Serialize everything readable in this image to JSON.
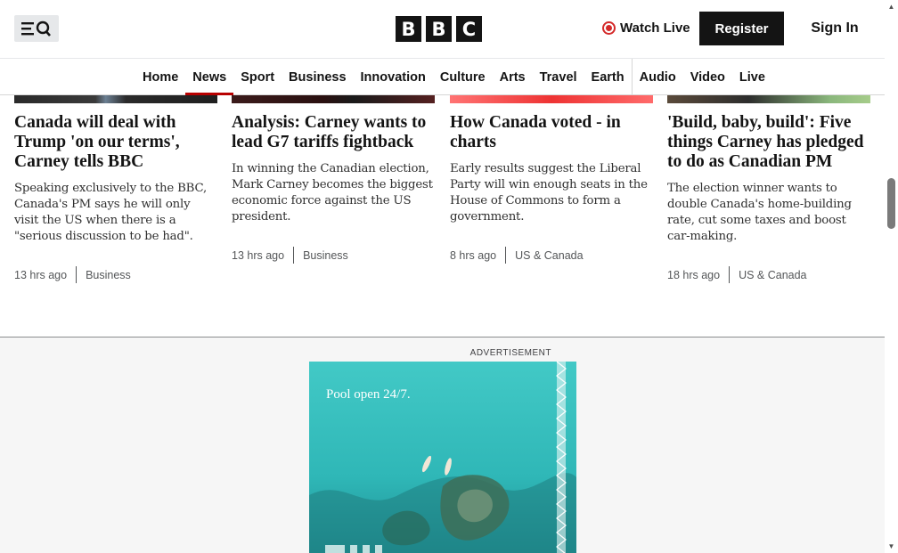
{
  "header": {
    "menu_icon": "menu-search-icon",
    "logo_letters": [
      "B",
      "B",
      "C"
    ],
    "watch_live": "Watch Live",
    "register": "Register",
    "sign_in": "Sign In",
    "accent": "#b80000"
  },
  "nav": {
    "items": [
      {
        "label": "Home"
      },
      {
        "label": "News"
      },
      {
        "label": "Sport"
      },
      {
        "label": "Business"
      },
      {
        "label": "Innovation"
      },
      {
        "label": "Culture"
      },
      {
        "label": "Arts"
      },
      {
        "label": "Travel"
      },
      {
        "label": "Earth"
      },
      {
        "label": "Audio"
      },
      {
        "label": "Video"
      },
      {
        "label": "Live"
      }
    ],
    "active": "News"
  },
  "cards": [
    {
      "title": "Canada will deal with Trump 'on our terms', Carney tells BBC",
      "summary": "Speaking exclusively to the BBC, Canada's PM says he will only visit the US when there is a \"serious discussion to be had\".",
      "time": "13 hrs ago",
      "category": "Business"
    },
    {
      "title": "Analysis: Carney wants to lead G7 tariffs fightback",
      "summary": "In winning the Canadian election, Mark Carney becomes the biggest economic force against the US president.",
      "time": "13 hrs ago",
      "category": "Business"
    },
    {
      "title": "How Canada voted - in charts",
      "summary": "Early results suggest the Liberal Party will win enough seats in the House of Commons to form a government.",
      "time": "8 hrs ago",
      "category": "US & Canada"
    },
    {
      "title": "'Build, baby, build': Five things Carney has pledged to do as Canadian PM",
      "summary": "The election winner wants to double Canada's home-building rate, cut some taxes and boost car-making.",
      "time": "18 hrs ago",
      "category": "US & Canada"
    }
  ],
  "ad": {
    "label": "ADVERTISEMENT",
    "headline": "Pool open 24/7."
  }
}
